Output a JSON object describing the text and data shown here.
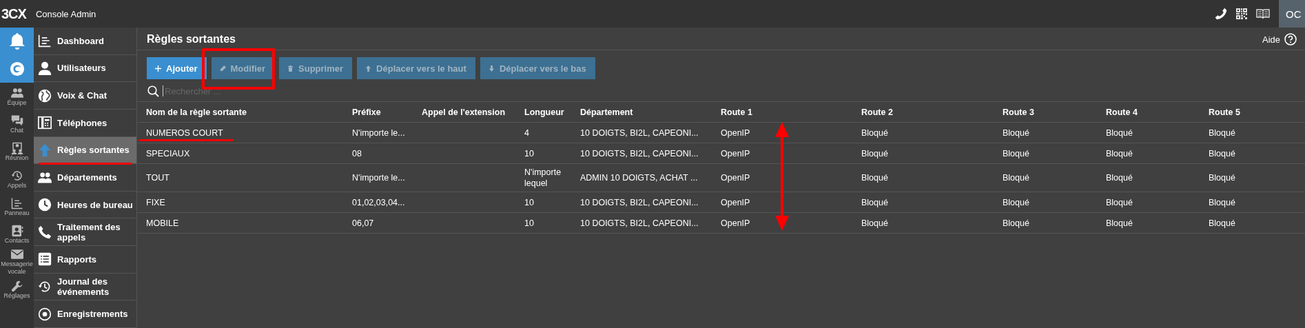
{
  "app": {
    "logo": "3CX",
    "title": "Console Admin",
    "user_initials": "OC"
  },
  "rail": [
    {
      "label": "Équipe"
    },
    {
      "label": "Chat"
    },
    {
      "label": "Réunion"
    },
    {
      "label": "Appels"
    },
    {
      "label": "Panneau"
    },
    {
      "label": "Contacts"
    },
    {
      "label": "Messagerie vocale"
    },
    {
      "label": "Réglages"
    }
  ],
  "nav": [
    {
      "label": "Dashboard",
      "selected": false
    },
    {
      "label": "Utilisateurs",
      "selected": false
    },
    {
      "label": "Voix & Chat",
      "selected": false
    },
    {
      "label": "Téléphones",
      "selected": false
    },
    {
      "label": "Règles sortantes",
      "selected": true
    },
    {
      "label": "Départements",
      "selected": false
    },
    {
      "label": "Heures de bureau",
      "selected": false
    },
    {
      "label": "Traitement des appels",
      "selected": false
    },
    {
      "label": "Rapports",
      "selected": false
    },
    {
      "label": "Journal des événements",
      "selected": false
    },
    {
      "label": "Enregistrements",
      "selected": false
    }
  ],
  "page": {
    "title": "Règles sortantes",
    "help": "Aide"
  },
  "toolbar": [
    {
      "label": "Ajouter",
      "disabled": false
    },
    {
      "label": "Modifier",
      "disabled": true
    },
    {
      "label": "Supprimer",
      "disabled": true
    },
    {
      "label": "Déplacer vers le haut",
      "disabled": true
    },
    {
      "label": "Déplacer vers le bas",
      "disabled": true
    }
  ],
  "search": {
    "placeholder": "Rechercher ..."
  },
  "table": {
    "columns": [
      "Nom de la règle sortante",
      "Préfixe",
      "Appel de l'extension",
      "Longueur",
      "Département",
      "Route 1",
      "Route 2",
      "Route 3",
      "Route 4",
      "Route 5"
    ],
    "rows": [
      [
        "NUMEROS COURT",
        "N'importe le...",
        "",
        "4",
        "10 DOIGTS, BI2L, CAPEONI...",
        "OpenIP",
        "Bloqué",
        "Bloqué",
        "Bloqué",
        "Bloqué"
      ],
      [
        "SPECIAUX",
        "08",
        "",
        "10",
        "10 DOIGTS, BI2L, CAPEONI...",
        "OpenIP",
        "Bloqué",
        "Bloqué",
        "Bloqué",
        "Bloqué"
      ],
      [
        "TOUT",
        "N'importe le...",
        "",
        "N'importe lequel",
        "ADMIN 10 DOIGTS, ACHAT ...",
        "OpenIP",
        "Bloqué",
        "Bloqué",
        "Bloqué",
        "Bloqué"
      ],
      [
        "FIXE",
        "01,02,03,04...",
        "",
        "10",
        "10 DOIGTS, BI2L, CAPEONI...",
        "OpenIP",
        "Bloqué",
        "Bloqué",
        "Bloqué",
        "Bloqué"
      ],
      [
        "MOBILE",
        "06,07",
        "",
        "10",
        "10 DOIGTS, BI2L, CAPEONI...",
        "OpenIP",
        "Bloqué",
        "Bloqué",
        "Bloqué",
        "Bloqué"
      ]
    ]
  }
}
